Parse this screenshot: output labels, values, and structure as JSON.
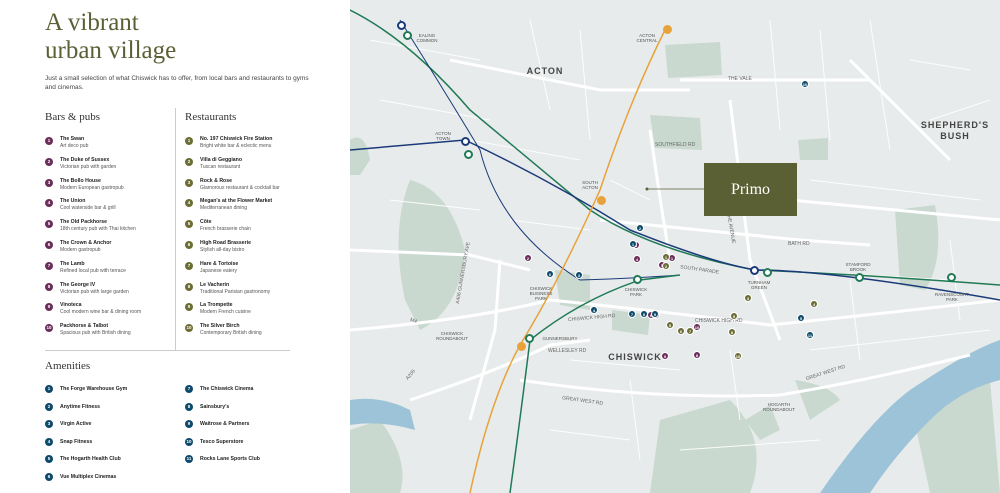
{
  "heading": {
    "line1": "A vibrant",
    "line2": "urban village"
  },
  "intro": "Just a small selection of what Chiswick has to offer, from local bars and restaurants to gyms and cinemas.",
  "colors": {
    "bars": "#6b2e5a",
    "restaurants": "#6c6d35",
    "amenities": "#0d4a6b",
    "primo": "#5b5f34",
    "park": "#c8d8ce",
    "water": "#9dc3d8",
    "overground": "#e8a23a",
    "district": "#1f7a55",
    "piccadilly": "#1a3a7a"
  },
  "bars": {
    "title": "Bars & pubs",
    "items": [
      {
        "n": "1",
        "name": "The Swan",
        "desc": "Art deco pub"
      },
      {
        "n": "2",
        "name": "The Duke of Sussex",
        "desc": "Victorian pub with garden"
      },
      {
        "n": "3",
        "name": "The Bollo House",
        "desc": "Modern European gastropub"
      },
      {
        "n": "4",
        "name": "The Union",
        "desc": "Cool waterside bar & grill"
      },
      {
        "n": "5",
        "name": "The Old Packhorse",
        "desc": "18th century pub with Thai kitchen"
      },
      {
        "n": "6",
        "name": "The Crown & Anchor",
        "desc": "Modern gastropub"
      },
      {
        "n": "7",
        "name": "The Lamb",
        "desc": "Refined local pub with terrace"
      },
      {
        "n": "8",
        "name": "The George IV",
        "desc": "Victorian pub with large garden"
      },
      {
        "n": "9",
        "name": "Vinoteca",
        "desc": "Cool modern wine bar & dining room"
      },
      {
        "n": "10",
        "name": "Packhorse & Talbot",
        "desc": "Spacious pub with British dining"
      }
    ]
  },
  "restaurants": {
    "title": "Restaurants",
    "items": [
      {
        "n": "1",
        "name": "No. 197 Chiswick Fire Station",
        "desc": "Bright white bar & eclectic menu"
      },
      {
        "n": "2",
        "name": "Villa di Geggiano",
        "desc": "Tuscan restaurant"
      },
      {
        "n": "3",
        "name": "Rock & Rose",
        "desc": "Glamorous restaurant & cocktail bar"
      },
      {
        "n": "4",
        "name": "Megan's at the Flower Market",
        "desc": "Mediterranean dining"
      },
      {
        "n": "5",
        "name": "Côte",
        "desc": "French brasserie chain"
      },
      {
        "n": "6",
        "name": "High Road Brasserie",
        "desc": "Stylish all-day bistro"
      },
      {
        "n": "7",
        "name": "Hare & Tortoise",
        "desc": "Japanese eatery"
      },
      {
        "n": "8",
        "name": "Le Vacherin",
        "desc": "Traditional Parisian gastronomy"
      },
      {
        "n": "9",
        "name": "La Trompette",
        "desc": "Modern French cuisine"
      },
      {
        "n": "10",
        "name": "The Silver Birch",
        "desc": "Contemporary British dining"
      }
    ]
  },
  "amenities": {
    "title": "Amenities",
    "col1": [
      {
        "n": "1",
        "name": "The Forge Warehouse Gym"
      },
      {
        "n": "2",
        "name": "Anytime Fitness"
      },
      {
        "n": "3",
        "name": "Virgin Active"
      },
      {
        "n": "4",
        "name": "Snap Fitness"
      },
      {
        "n": "5",
        "name": "The Hogarth Health Club"
      },
      {
        "n": "6",
        "name": "Vue Multiplex Cinemas"
      }
    ],
    "col2": [
      {
        "n": "7",
        "name": "The Chiswick Cinema"
      },
      {
        "n": "8",
        "name": "Sainsbury's"
      },
      {
        "n": "9",
        "name": "Waitrose & Partners"
      },
      {
        "n": "10",
        "name": "Tesco Superstore"
      },
      {
        "n": "11",
        "name": "Rocks Lane Sports Club"
      }
    ]
  },
  "map": {
    "primo": "Primo",
    "areas": {
      "acton": "ACTON",
      "shepherds_bush": "SHEPHERD'S\nBUSH",
      "chiswick": "CHISWICK"
    },
    "stations": {
      "ealing_common": "EALING\nCOMMON",
      "acton_central": "ACTON\nCENTRAL",
      "acton_town": "ACTON\nTOWN",
      "south_acton": "SOUTH\nACTON",
      "chiswick_park": "CHISWICK\nPARK",
      "turnham_green": "TURNHAM\nGREEN",
      "stamford_brook": "STAMFORD\nBROOK",
      "ravenscourt_park": "RAVENSCOURT\nPARK",
      "gunnersbury": "GUNNERSBURY",
      "chiswick_business_park": "CHISWICK\nBUSINESS\nPARK",
      "chiswick_roundabout": "CHISWICK\nROUNDABOUT",
      "hogarth_roundabout": "HOGARTH\nROUNDABOUT"
    },
    "roads": {
      "m4": "M4",
      "a205": "A205",
      "a406": "A406 GUNNERSBURY AVE",
      "great_west_rd": "GREAT WEST RD",
      "great_west_rd2": "GREAT WEST RD",
      "chiswick_high_rd": "CHISWICK HIGH RD",
      "south_parade": "SOUTH PARADE",
      "bath_rd": "BATH RD",
      "southfield_rd": "SOUTHFIELD RD",
      "wellesley_rd": "WELLESLEY RD",
      "the_vale": "THE VALE",
      "the_avenue": "THE AVENUE"
    },
    "markers": {
      "bars": [
        "1",
        "2",
        "3",
        "4",
        "5",
        "6",
        "7",
        "8",
        "9",
        "10"
      ],
      "restaurants": [
        "1",
        "2",
        "3",
        "4",
        "5",
        "6",
        "7",
        "8",
        "9",
        "10"
      ],
      "amenities": [
        "1",
        "2",
        "3",
        "4",
        "5",
        "6",
        "7",
        "8",
        "9",
        "10",
        "11"
      ]
    }
  }
}
